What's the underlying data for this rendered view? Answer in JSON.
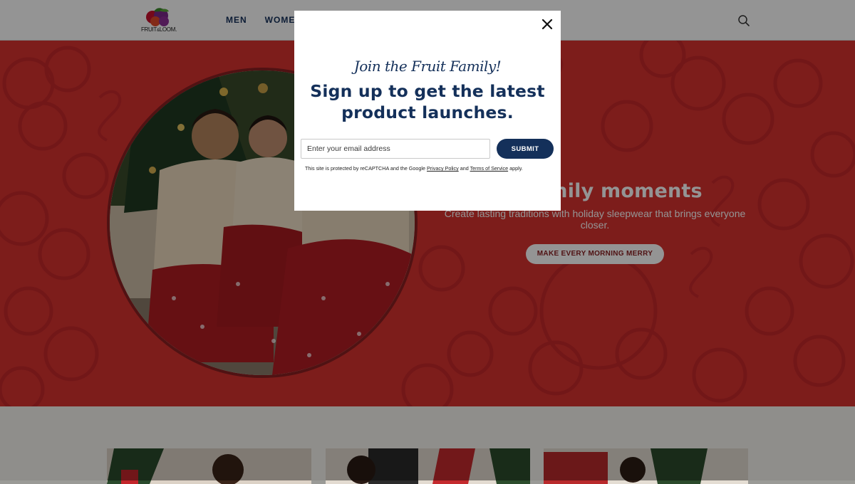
{
  "header": {
    "logo_text": "FRUIT☃LOOM.",
    "nav": [
      "MEN",
      "WOMEN"
    ],
    "search_icon": "search-icon"
  },
  "hero": {
    "title": "for family moments",
    "subtitle": "Create lasting traditions with holiday sleepwear that brings everyone closer.",
    "cta_label": "MAKE EVERY MORNING MERRY"
  },
  "modal": {
    "close_icon": "close-icon",
    "eyebrow": "Join the Fruit Family!",
    "heading_line1": "Sign up to get the latest",
    "heading_line2": "product launches.",
    "email_placeholder": "Enter your email address",
    "submit_label": "SUBMIT",
    "legal_prefix": "This site is protected by reCAPTCHA and the Google ",
    "privacy_link": "Privacy Policy",
    "legal_and": " and ",
    "terms_link": "Terms of Service",
    "legal_suffix": " apply."
  },
  "colors": {
    "brand_navy": "#14305a",
    "hero_red": "#d7322f",
    "hero_dark_red": "#8a1f22"
  }
}
